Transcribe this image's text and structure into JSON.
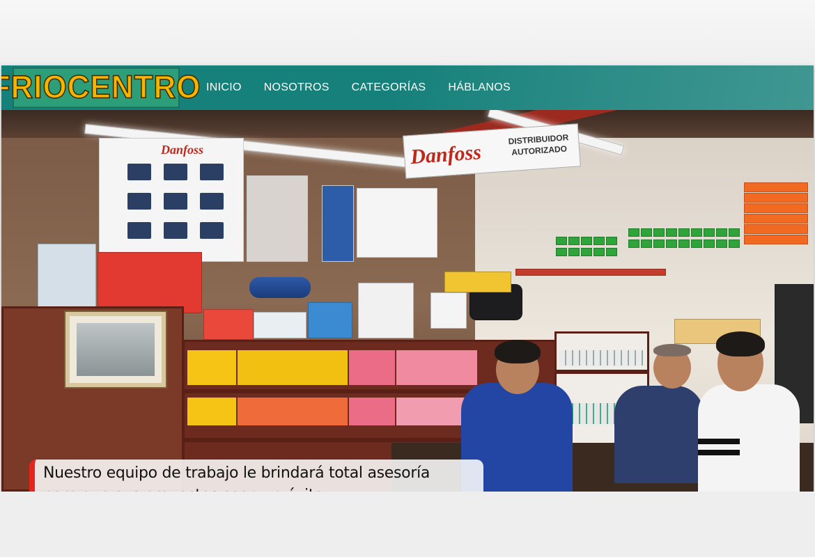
{
  "header": {
    "logo_text": "FRIOCENTRO",
    "nav": [
      {
        "label": "INICIO"
      },
      {
        "label": "NOSOTROS"
      },
      {
        "label": "CATEGORÍAS"
      },
      {
        "label": "HÁBLANOS"
      }
    ]
  },
  "hero": {
    "caption_line1": "Nuestro equipo de trabajo le brindará total asesoría",
    "caption_line2": "para que sus proyectos sean un éxito.",
    "store_sign": {
      "brand": "Danfoss",
      "text_line1": "DISTRIBUIDOR",
      "text_line2": "AUTORIZADO"
    },
    "poster_brand": "Danfoss"
  },
  "colors": {
    "navbar": "#16807a",
    "logo_text": "#f5b400",
    "logo_bg": "#2c9e7a",
    "caption_accent": "#e5261f"
  }
}
